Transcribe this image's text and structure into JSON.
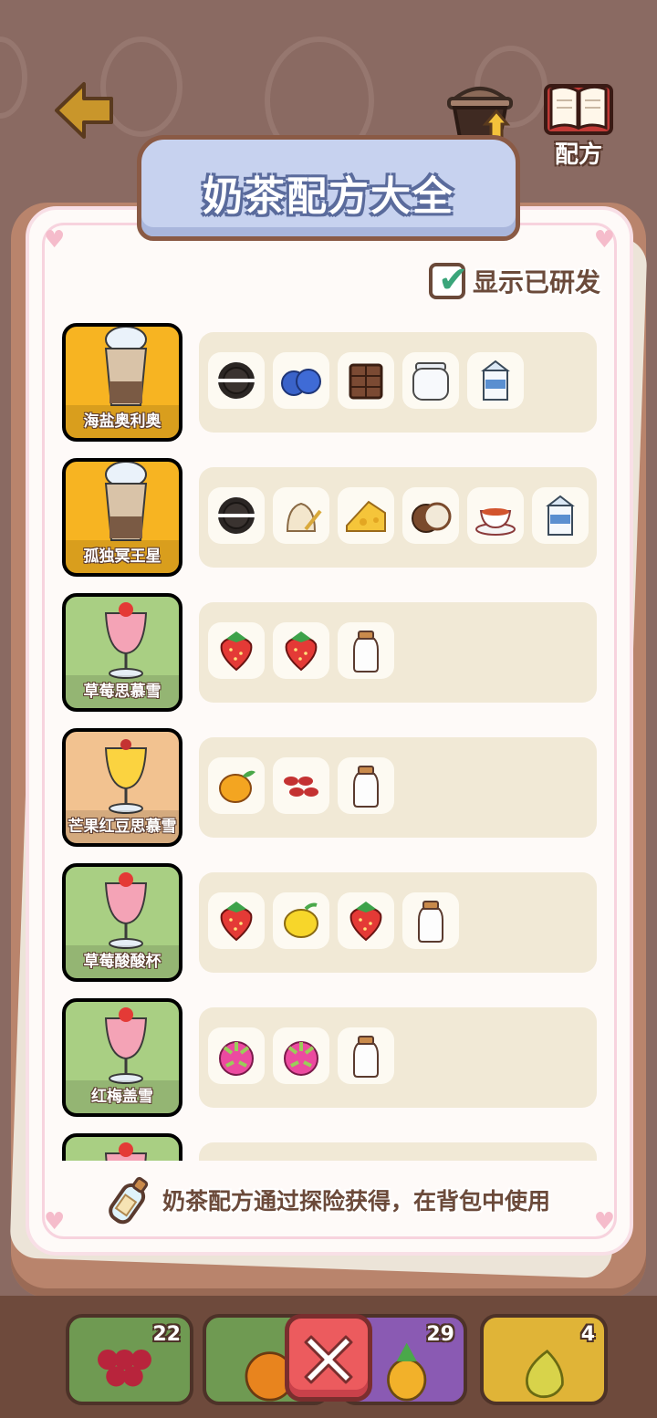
{
  "header": {
    "upgrade_label": "升级",
    "recipe_label": "配方"
  },
  "panel": {
    "title": "奶茶配方大全",
    "filter_label": "显示已研发",
    "filter_checked": true,
    "hint": "奶茶配方通过探险获得，在背包中使用"
  },
  "recipes": [
    {
      "name": "海盐奥利奥",
      "card_color": "#f7b422",
      "ingredients": [
        "oreo",
        "blueberry",
        "chocolate",
        "jar",
        "milk-carton"
      ]
    },
    {
      "name": "孤独冥王星",
      "card_color": "#f7b422",
      "ingredients": [
        "oreo",
        "flour",
        "cheese",
        "coconut",
        "tea",
        "milk-carton"
      ]
    },
    {
      "name": "草莓思慕雪",
      "card_color": "#a9cf83",
      "ingredients": [
        "strawberry",
        "strawberry",
        "milk-bottle"
      ]
    },
    {
      "name": "芒果红豆思慕雪",
      "card_color": "#f2c290",
      "ingredients": [
        "mango",
        "red-beans",
        "milk-bottle"
      ]
    },
    {
      "name": "草莓酸酸杯",
      "card_color": "#a9cf83",
      "ingredients": [
        "strawberry",
        "lemon",
        "strawberry",
        "milk-bottle"
      ]
    },
    {
      "name": "红梅盖雪",
      "card_color": "#a9cf83",
      "ingredients": [
        "dragon-fruit",
        "dragon-fruit",
        "milk-bottle"
      ]
    },
    {
      "name": "",
      "card_color": "#a9cf83",
      "ingredients": []
    }
  ],
  "tray": [
    {
      "item": "grapes",
      "count": "22",
      "color": "#6f9a52"
    },
    {
      "item": "orange",
      "count": "",
      "color": "#6f9a52"
    },
    {
      "item": "pineapple",
      "count": "29",
      "color": "#8a5ab3"
    },
    {
      "item": "pear",
      "count": "4",
      "color": "#e0b437"
    }
  ]
}
